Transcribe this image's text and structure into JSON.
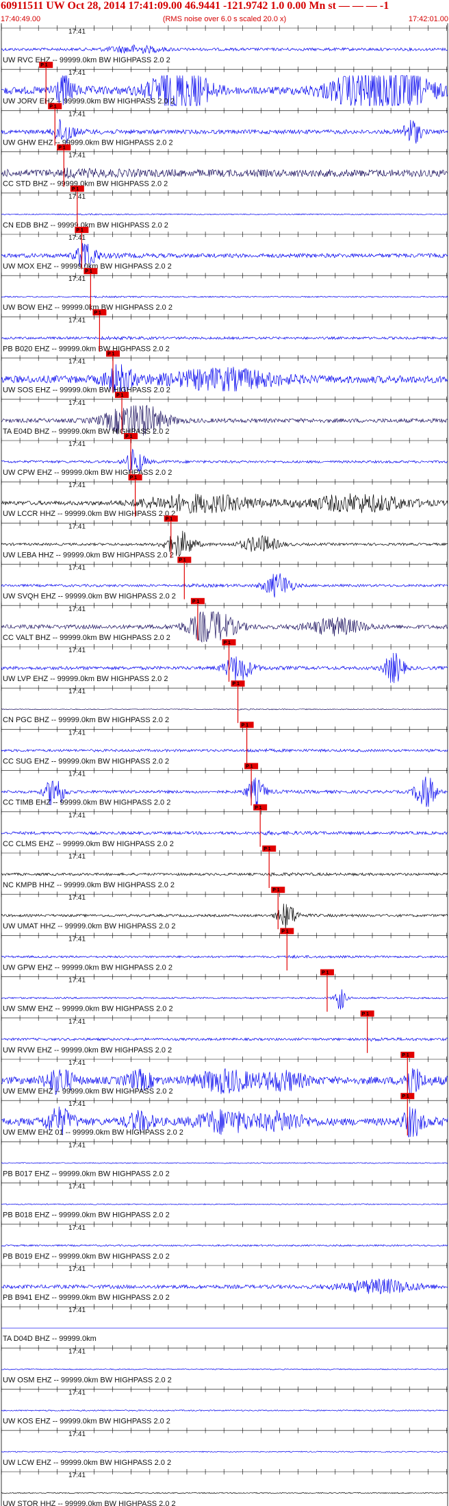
{
  "header": {
    "title": "60911511 UW Oct 28, 2014 17:41:09.00   46.9441 -121.9742  1.0 0.00 Mn st — — — -1",
    "start_time": "17:40:49.00",
    "note": "(RMS noise over 6.0 s scaled 20.0 x)",
    "end_time": "17:42:01.00"
  },
  "time_tick_label": "17:41",
  "pick_label": "P 1",
  "traces": [
    {
      "label": "UW RVC EHZ -- 99999.0km BW  HIGHPASS  2.0  2",
      "color": "#0000ee",
      "pick": null,
      "amp": 0.35,
      "bursts": [
        [
          0.3,
          0.06,
          0.8
        ]
      ]
    },
    {
      "label": "UW JORV EHZ -- 99999.0km BW  HIGHPASS  2.0  2",
      "color": "#0000ee",
      "pick": 0.1,
      "amp": 0.9,
      "bursts": [
        [
          0.14,
          0.02,
          3.0
        ],
        [
          0.4,
          0.06,
          6.0
        ],
        [
          0.85,
          0.1,
          6.0
        ]
      ]
    },
    {
      "label": "UW GHW EHZ -- 99999.0km BW  HIGHPASS  2.0  2",
      "color": "#0000ee",
      "pick": 0.12,
      "amp": 0.5,
      "bursts": [
        [
          0.14,
          0.02,
          3.0
        ],
        [
          0.92,
          0.02,
          3.0
        ]
      ]
    },
    {
      "label": "CC STD BHZ -- 99999.0km BW  HIGHPASS  2.0  2",
      "color": "#1a0f5e",
      "pick": 0.14,
      "amp": 0.9,
      "bursts": []
    },
    {
      "label": "CN EDB BHZ -- 99999.0km BW  HIGHPASS  2.0  2",
      "color": "#0000ee",
      "pick": 0.17,
      "amp": 0.12,
      "bursts": []
    },
    {
      "label": "UW MOX EHZ -- 99999.0km BW  HIGHPASS  2.0  2",
      "color": "#0000ee",
      "pick": 0.18,
      "amp": 0.5,
      "bursts": [
        [
          0.19,
          0.02,
          4.0
        ]
      ]
    },
    {
      "label": "UW BOW EHZ -- 99999.0km BW  HIGHPASS  2.0  2",
      "color": "#0000ee",
      "pick": 0.2,
      "amp": 0.15,
      "bursts": []
    },
    {
      "label": "PB B020 EHZ -- 99999.0km BW  HIGHPASS  2.0  2",
      "color": "#0000ee",
      "pick": 0.22,
      "amp": 0.3,
      "bursts": []
    },
    {
      "label": "UW SOS EHZ -- 99999.0km BW  HIGHPASS  2.0  2",
      "color": "#0000ee",
      "pick": 0.25,
      "amp": 0.9,
      "bursts": [
        [
          0.26,
          0.03,
          3.0
        ],
        [
          0.5,
          0.12,
          2.2
        ]
      ]
    },
    {
      "label": "TA E04D BHZ -- 99999.0km BW  HIGHPASS  2.0  2",
      "color": "#1a0f5e",
      "pick": 0.27,
      "amp": 0.5,
      "bursts": [
        [
          0.3,
          0.06,
          4.5
        ]
      ]
    },
    {
      "label": "UW CPW EHZ -- 99999.0km BW  HIGHPASS  2.0  2",
      "color": "#0000ee",
      "pick": 0.29,
      "amp": 0.3,
      "bursts": [
        [
          0.3,
          0.02,
          3.0
        ]
      ]
    },
    {
      "label": "UW LCCR HHZ -- 99999.0km BW  HIGHPASS  2.0  2",
      "color": "#000000",
      "pick": 0.3,
      "amp": 0.5,
      "bursts": [
        [
          0.45,
          0.12,
          2.0
        ],
        [
          0.8,
          0.12,
          2.0
        ]
      ]
    },
    {
      "label": "UW LEBA HHZ -- 99999.0km BW  HIGHPASS  2.0  2",
      "color": "#000000",
      "pick": 0.38,
      "amp": 0.3,
      "bursts": [
        [
          0.4,
          0.03,
          3.0
        ],
        [
          0.58,
          0.04,
          2.0
        ]
      ]
    },
    {
      "label": "UW SVQH EHZ -- 99999.0km BW  HIGHPASS  2.0  2",
      "color": "#0000ee",
      "pick": 0.41,
      "amp": 0.3,
      "bursts": [
        [
          0.62,
          0.03,
          3.0
        ]
      ]
    },
    {
      "label": "CC VALT BHZ -- 99999.0km BW  HIGHPASS  2.0  2",
      "color": "#1a0f5e",
      "pick": 0.44,
      "amp": 0.5,
      "bursts": [
        [
          0.47,
          0.05,
          4.0
        ],
        [
          0.75,
          0.06,
          2.0
        ]
      ]
    },
    {
      "label": "UW LVP EHZ -- 99999.0km BW  HIGHPASS  2.0  2",
      "color": "#0000ee",
      "pick": 0.51,
      "amp": 0.4,
      "bursts": [
        [
          0.53,
          0.03,
          3.0
        ],
        [
          0.88,
          0.02,
          4.0
        ]
      ]
    },
    {
      "label": "CN PGC BHZ -- 99999.0km BW  HIGHPASS  2.0  2",
      "color": "#1a0f5e",
      "pick": 0.53,
      "amp": 0.1,
      "bursts": []
    },
    {
      "label": "CC SUG EHZ -- 99999.0km BW  HIGHPASS  2.0  2",
      "color": "#0000ee",
      "pick": 0.55,
      "amp": 0.3,
      "bursts": []
    },
    {
      "label": "CC TIMB EHZ -- 99999.0km BW  HIGHPASS  2.0  2",
      "color": "#0000ee",
      "pick": 0.56,
      "amp": 0.35,
      "bursts": [
        [
          0.12,
          0.02,
          4.0
        ],
        [
          0.57,
          0.02,
          3.0
        ],
        [
          0.95,
          0.02,
          5.0
        ]
      ]
    },
    {
      "label": "CC CLMS EHZ -- 99999.0km BW  HIGHPASS  2.0  2",
      "color": "#0000ee",
      "pick": 0.58,
      "amp": 0.35,
      "bursts": []
    },
    {
      "label": "NC KMPB HHZ -- 99999.0km BW  HIGHPASS  2.0  2",
      "color": "#000000",
      "pick": 0.6,
      "amp": 0.3,
      "bursts": []
    },
    {
      "label": "UW UMAT HHZ -- 99999.0km BW  HIGHPASS  2.0  2",
      "color": "#000000",
      "pick": 0.62,
      "amp": 0.3,
      "bursts": [
        [
          0.64,
          0.02,
          3.0
        ]
      ]
    },
    {
      "label": "UW GPW EHZ -- 99999.0km BW  HIGHPASS  2.0  2",
      "color": "#0000ee",
      "pick": 0.64,
      "amp": 0.25,
      "bursts": []
    },
    {
      "label": "UW SMW EHZ -- 99999.0km BW  HIGHPASS  2.0  2",
      "color": "#0000ee",
      "pick": 0.73,
      "amp": 0.2,
      "bursts": [
        [
          0.76,
          0.01,
          3.0
        ]
      ]
    },
    {
      "label": "UW RVW EHZ -- 99999.0km BW  HIGHPASS  2.0  2",
      "color": "#0000ee",
      "pick": 0.82,
      "amp": 0.3,
      "bursts": []
    },
    {
      "label": "UW EMW EHZ -- 99999.0km BW  HIGHPASS  2.0  2",
      "color": "#0000ee",
      "pick": 0.91,
      "amp": 0.9,
      "bursts": [
        [
          0.13,
          0.03,
          3.0
        ],
        [
          0.31,
          0.03,
          2.0
        ],
        [
          0.5,
          0.06,
          2.5
        ],
        [
          0.63,
          0.05,
          2.0
        ],
        [
          0.92,
          0.02,
          3.0
        ]
      ]
    },
    {
      "label": "UW EMW EHZ 01 -- 99999.0km BW  HIGHPASS  2.0  2",
      "color": "#0000ee",
      "pick": 0.91,
      "amp": 0.9,
      "bursts": [
        [
          0.13,
          0.03,
          3.0
        ],
        [
          0.31,
          0.03,
          2.0
        ],
        [
          0.5,
          0.06,
          2.5
        ],
        [
          0.63,
          0.05,
          2.0
        ],
        [
          0.92,
          0.02,
          3.0
        ]
      ]
    },
    {
      "label": "PB B017 EHZ -- 99999.0km BW  HIGHPASS  2.0  2",
      "color": "#0000ee",
      "pick": null,
      "amp": 0.12,
      "bursts": []
    },
    {
      "label": "PB B018 EHZ -- 99999.0km BW  HIGHPASS  2.0  2",
      "color": "#0000ee",
      "pick": null,
      "amp": 0.12,
      "bursts": []
    },
    {
      "label": "PB B019 EHZ -- 99999.0km BW  HIGHPASS  2.0  2",
      "color": "#0000ee",
      "pick": null,
      "amp": 0.2,
      "bursts": []
    },
    {
      "label": "PB B941 EHZ -- 99999.0km BW  HIGHPASS  2.0  2",
      "color": "#0000ee",
      "pick": null,
      "amp": 0.45,
      "bursts": [
        [
          0.85,
          0.08,
          1.6
        ]
      ]
    },
    {
      "label": "TA D04D BHZ -- 99999.0km",
      "color": "#0000ee",
      "pick": null,
      "amp": 0.0,
      "bursts": []
    },
    {
      "label": "UW OSM EHZ -- 99999.0km BW  HIGHPASS  2.0  2",
      "color": "#0000ee",
      "pick": null,
      "amp": 0.12,
      "bursts": []
    },
    {
      "label": "UW KOS EHZ -- 99999.0km BW  HIGHPASS  2.0  2",
      "color": "#0000ee",
      "pick": null,
      "amp": 0.15,
      "bursts": []
    },
    {
      "label": "UW LCW EHZ -- 99999.0km BW  HIGHPASS  2.0  2",
      "color": "#0000ee",
      "pick": null,
      "amp": 0.12,
      "bursts": []
    },
    {
      "label": "UW STOR HHZ -- 99999.0km BW  HIGHPASS  2.0  2",
      "color": "#000000",
      "pick": null,
      "amp": 0.12,
      "bursts": []
    }
  ]
}
